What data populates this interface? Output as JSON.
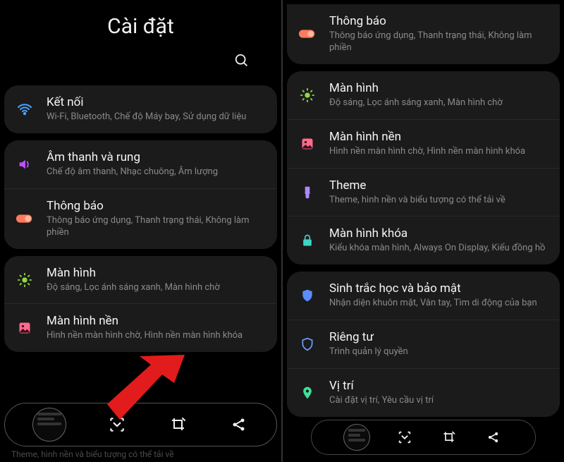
{
  "header": {
    "title": "Cài đặt"
  },
  "icons": {
    "wifi": "wifi",
    "sound": "sound",
    "notif": "switch",
    "display": "brightness",
    "wallpaper": "picture",
    "theme": "brush",
    "lock": "lock",
    "biometric": "shield-fill",
    "privacy": "shield-outline",
    "location": "location"
  },
  "left": {
    "groups": [
      {
        "items": [
          {
            "icon": "wifi",
            "color": "#4aa3ff",
            "title": "Kết nối",
            "sub": "Wi-Fi, Bluetooth, Chế độ Máy bay, Sử dụng dữ liệu"
          }
        ]
      },
      {
        "items": [
          {
            "icon": "sound",
            "color": "#c050ff",
            "title": "Âm thanh và rung",
            "sub": "Chế độ âm thanh, Nhạc chuông, Âm lượng"
          },
          {
            "icon": "switch",
            "color": "#ff7a5c",
            "title": "Thông báo",
            "sub": "Thông báo ứng dụng, Thanh trạng thái, Không làm phiền"
          }
        ]
      },
      {
        "items": [
          {
            "icon": "brightness",
            "color": "#8fd93f",
            "title": "Màn hình",
            "sub": "Độ sáng, Lọc ánh sáng xanh, Màn hình chờ"
          },
          {
            "icon": "picture",
            "color": "#ff6b8b",
            "title": "Màn hình nền",
            "sub": "Hình nền màn hình chờ, Hình nền màn hình khóa"
          }
        ]
      }
    ],
    "dimmed_row": "Theme, hình nền và biểu tượng có thể tải về"
  },
  "right": {
    "groups": [
      {
        "items": [
          {
            "icon": "switch",
            "color": "#ff7a5c",
            "title": "Thông báo",
            "sub": "Thông báo ứng dụng, Thanh trạng thái, Không làm phiền"
          }
        ]
      },
      {
        "items": [
          {
            "icon": "brightness",
            "color": "#8fd93f",
            "title": "Màn hình",
            "sub": "Độ sáng, Lọc ánh sáng xanh, Màn hình chờ"
          },
          {
            "icon": "picture",
            "color": "#ff6b8b",
            "title": "Màn hình nền",
            "sub": "Hình nền màn hình chờ, Hình nền màn hình khóa"
          },
          {
            "icon": "brush",
            "color": "#b087ff",
            "title": "Theme",
            "sub": "Theme, hình nền và biểu tượng có thể tải về"
          },
          {
            "icon": "lock",
            "color": "#3fd4c4",
            "title": "Màn hình khóa",
            "sub": "Kiểu khóa màn hình, Always On Display, Kiểu đồng hồ"
          }
        ]
      },
      {
        "items": [
          {
            "icon": "shield-fill",
            "color": "#5b8cff",
            "title": "Sinh trắc học và bảo mật",
            "sub": "Nhận diện khuôn mặt, Vân tay, Tìm di động của bạn"
          },
          {
            "icon": "shield-outline",
            "color": "#6aa0ff",
            "title": "Riêng tư",
            "sub": "Trình quản lý quyền"
          },
          {
            "icon": "location",
            "color": "#3fe09a",
            "title": "Vị trí",
            "sub": "Cài đặt vị trí, Yêu cầu vị trí"
          }
        ]
      }
    ]
  },
  "toolbar": {
    "scroll_capture": "scroll-capture",
    "crop": "crop",
    "share": "share"
  }
}
